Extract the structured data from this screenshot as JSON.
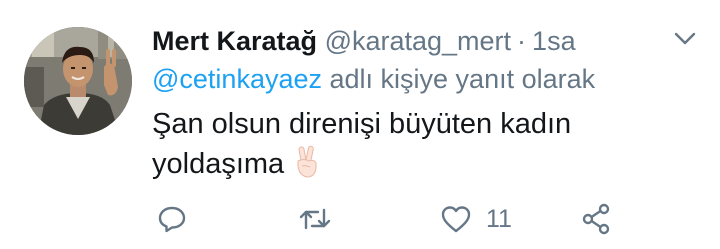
{
  "tweet": {
    "author": {
      "display_name": "Mert Karatağ",
      "handle": "@karatag_mert",
      "separator": "·",
      "time": "1sa"
    },
    "reply": {
      "mention": "@cetinkayaez",
      "suffix": " adlı kişiye yanıt olarak"
    },
    "text_line_1": "Şan olsun direnişi büyüten kadın",
    "text_line_2": "yoldaşıma",
    "emoji": "victory-hand-icon"
  },
  "actions": {
    "reply_icon": "reply-icon",
    "retweet_icon": "retweet-icon",
    "like_icon": "heart-icon",
    "like_count": "11",
    "share_icon": "share-icon"
  },
  "colors": {
    "text": "#14171a",
    "muted": "#657786",
    "link": "#1da1f2"
  }
}
